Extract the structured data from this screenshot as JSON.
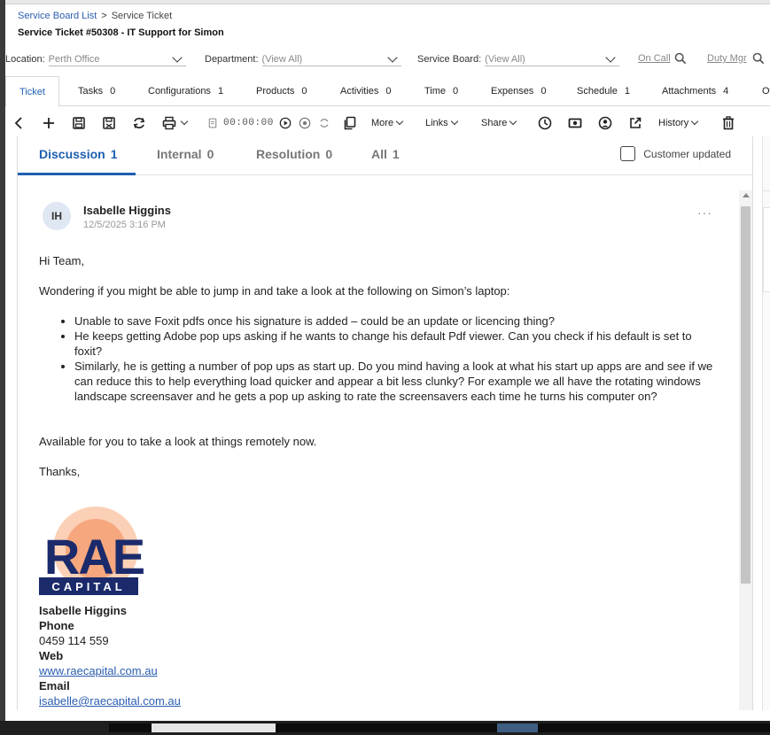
{
  "breadcrumb": {
    "parent": "Service Board List",
    "current": "Service Ticket"
  },
  "page_title": "Service Ticket #50308 - IT Support for Simon",
  "filters": {
    "location": {
      "label": "Location:",
      "value": "Perth Office"
    },
    "department": {
      "label": "Department:",
      "value": "(View All)"
    },
    "service_board": {
      "label": "Service Board:",
      "value": "(View All)"
    },
    "on_call": "On Call",
    "duty_mgr": "Duty Mgr"
  },
  "tabs": [
    {
      "label": "Ticket",
      "count": ""
    },
    {
      "label": "Tasks",
      "count": "0"
    },
    {
      "label": "Configurations",
      "count": "1"
    },
    {
      "label": "Products",
      "count": "0"
    },
    {
      "label": "Activities",
      "count": "0"
    },
    {
      "label": "Time",
      "count": "0"
    },
    {
      "label": "Expenses",
      "count": "0"
    },
    {
      "label": "Schedule",
      "count": "1"
    },
    {
      "label": "Attachments",
      "count": "4"
    },
    {
      "label": "Ot",
      "count": ""
    }
  ],
  "toolbar": {
    "timer": "00:00:00",
    "more": "More",
    "links": "Links",
    "share": "Share",
    "history": "History"
  },
  "subtabs": [
    {
      "label": "Discussion",
      "count": "1"
    },
    {
      "label": "Internal",
      "count": "0"
    },
    {
      "label": "Resolution",
      "count": "0"
    },
    {
      "label": "All",
      "count": "1"
    }
  ],
  "customer_updated": "Customer updated",
  "message": {
    "initials": "IH",
    "author": "Isabelle Higgins",
    "timestamp": "12/5/2025 3:16 PM",
    "greeting": "Hi Team,",
    "intro": "Wondering if you might be able to jump in and take a look at the following on Simon’s laptop:",
    "bullets": [
      "Unable to save Foxit pdfs once his signature is added – could be an update or licencing thing?",
      "He keeps getting Adobe pop ups asking if he wants to change his default Pdf viewer. Can you check if his default is set to foxit?",
      "Similarly, he is getting a number of pop ups as start up. Do you mind having a look at what his start up apps are and see if we can reduce this to help everything load quicker and appear a bit less clunky? For example we all have the rotating windows landscape screensaver and he gets a pop up asking to rate the screensavers each time he turns his computer on?"
    ],
    "availability": "Available for you to take a look at things remotely now.",
    "signoff": "Thanks,"
  },
  "logo": {
    "word": "RAE",
    "sub": "CAPITAL",
    "colors": {
      "navy": "#1b2a6b",
      "peach": "#f6a77d",
      "peach_light": "#fbd0b6"
    }
  },
  "signature": {
    "name": "Isabelle Higgins",
    "phone_label": "Phone",
    "phone": "0459 114 559",
    "web_label": "Web",
    "web": "www.raecapital.com.au",
    "email_label": "Email",
    "email": "isabelle@raecapital.com.au"
  },
  "colors": {
    "accent": "#1d5fb0",
    "link": "#2a5db0"
  }
}
